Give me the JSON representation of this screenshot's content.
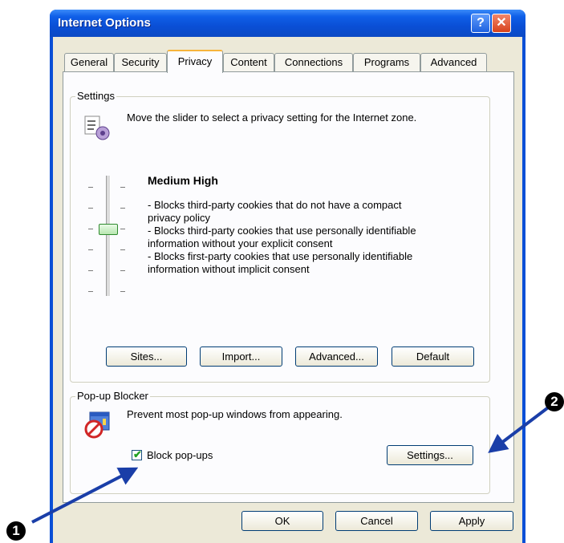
{
  "window": {
    "title": "Internet Options",
    "help_glyph": "?",
    "close_glyph": "✕"
  },
  "tabs": [
    "General",
    "Security",
    "Privacy",
    "Content",
    "Connections",
    "Programs",
    "Advanced"
  ],
  "active_tab": "Privacy",
  "settings_group": {
    "legend": "Settings",
    "intro": "Move the slider to select a privacy setting for the Internet zone.",
    "level_title": "Medium High",
    "desc_lines": [
      "- Blocks third-party cookies that do not have a compact",
      "privacy policy",
      "- Blocks third-party cookies that use personally identifiable",
      "information without your explicit consent",
      "- Blocks first-party cookies that use personally identifiable",
      "information without implicit consent"
    ],
    "slider_level": 2,
    "slider_steps": 6,
    "buttons": {
      "sites": "Sites...",
      "import": "Import...",
      "advanced": "Advanced...",
      "default": "Default"
    }
  },
  "popup_group": {
    "legend": "Pop-up Blocker",
    "description": "Prevent most pop-up windows from appearing.",
    "checkbox_label": "Block pop-ups",
    "checkbox_checked": true,
    "settings_button": "Settings..."
  },
  "footer": {
    "ok": "OK",
    "cancel": "Cancel",
    "apply": "Apply"
  },
  "annotations": {
    "marker1": "1",
    "marker2": "2"
  },
  "colors": {
    "titlebar": "#0a4fd6",
    "dialog_bg": "#ece9d8",
    "arrow": "#1a3ea8"
  }
}
